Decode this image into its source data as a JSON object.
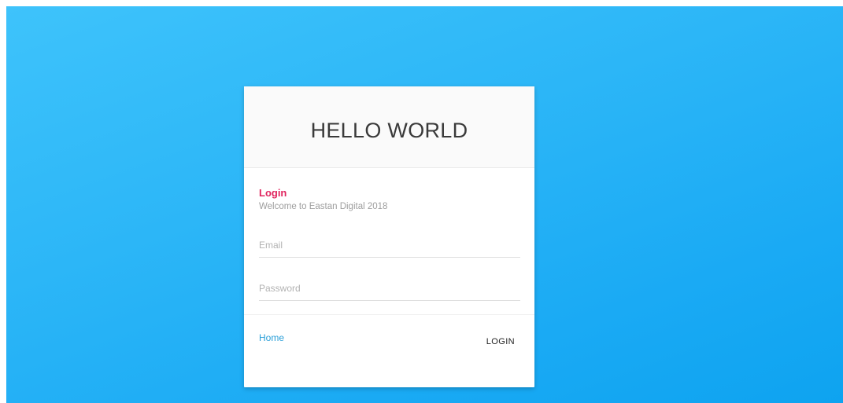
{
  "card": {
    "title": "HELLO WORLD",
    "heading": "Login",
    "subtitle": "Welcome to Eastan Digital 2018"
  },
  "form": {
    "email_placeholder": "Email",
    "email_value": "",
    "password_placeholder": "Password",
    "password_value": ""
  },
  "footer": {
    "home_label": "Home",
    "login_label": "LOGIN"
  },
  "colors": {
    "background_top": "#3ec3fb",
    "background_bottom": "#0ea3f0",
    "heading_accent": "#e0245e",
    "link": "#2a9fd8"
  }
}
